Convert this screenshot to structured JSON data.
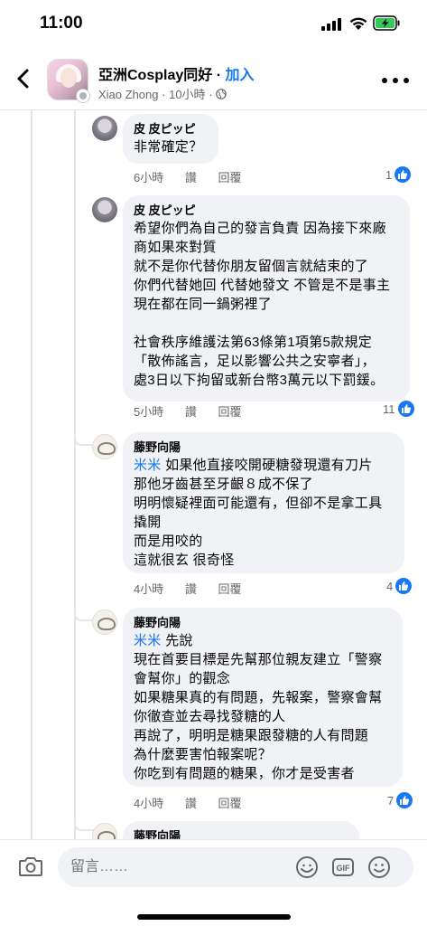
{
  "status_bar": {
    "time": "11:00"
  },
  "header": {
    "group_name": "亞洲Cosplay同好",
    "join_label": "加入",
    "author": "Xiao Zhong",
    "separator": "·",
    "time": "10小時",
    "icons": [
      "back-arrow-icon",
      "globe-icon",
      "more-icon"
    ]
  },
  "comments": [
    {
      "author": "皮 皮ピッピ",
      "lines": [
        "非常確定？"
      ],
      "time": "6小時",
      "like_label": "讚",
      "reply_label": "回覆",
      "reactions": "1"
    },
    {
      "author": "皮 皮ピッピ",
      "lines": [
        "希望你們為自己的發言負責 因為接下來廠",
        "商如果來對質",
        "就不是你代替你朋友留個言就結束的了",
        "你們代替她回 代替她發文 不管是不是事主",
        "現在都在同一鍋粥裡了",
        "",
        "社會秩序維護法第63條第1項第5款規定",
        "「散佈謠言，足以影響公共之安寧者」，",
        "處3日以下拘留或新台幣3萬元以下罰鍰。"
      ],
      "time": "5小時",
      "like_label": "讚",
      "reply_label": "回覆",
      "reactions": "11"
    },
    {
      "author": "藤野向陽",
      "tag": "米米",
      "lines": [
        " 如果他直接咬開硬糖發現還有刀片",
        "那他牙齒甚至牙齦８成不保了",
        "明明懷疑裡面可能還有，但卻不是拿工具",
        "撬開",
        "而是用咬的",
        "這就很玄 很奇怪"
      ],
      "time": "4小時",
      "like_label": "讚",
      "reply_label": "回覆",
      "reactions": "4"
    },
    {
      "author": "藤野向陽",
      "tag": "米米",
      "lines": [
        " 先說",
        "現在首要目標是先幫那位親友建立「警察",
        "會幫你」的觀念",
        "如果糖果真的有問題，先報案，警察會幫",
        "你徹查並去尋找發糖的人",
        "再說了，明明是糖果跟發糖的人有問題",
        "為什麼要害怕報案呢？",
        "你吃到有問題的糖果，你才是受害者"
      ],
      "time": "4小時",
      "like_label": "讚",
      "reply_label": "回覆",
      "reactions": "7"
    },
    {
      "author": "藤野向陽"
    }
  ],
  "composer": {
    "placeholder": "留言……",
    "icons": [
      "camera-icon",
      "sticker-icon",
      "gif-icon",
      "emoji-icon"
    ],
    "gif_label": "GIF"
  }
}
